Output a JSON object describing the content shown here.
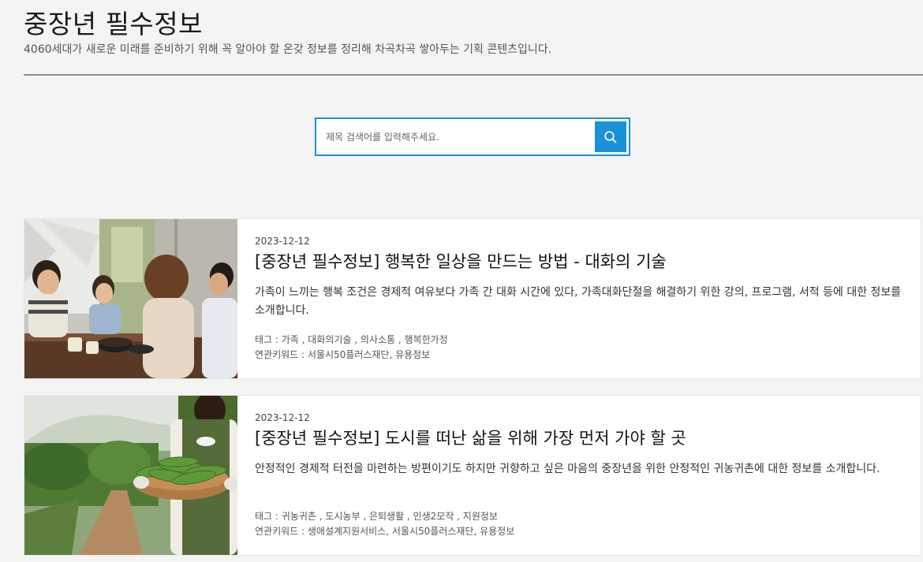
{
  "header": {
    "title": "중장년 필수정보",
    "description": "4060세대가 새로운 미래를 준비하기 위해 꼭 알아야 할 온갖 정보를 정리해 차곡차곡 쌓아두는 기획 콘텐츠입니다."
  },
  "search": {
    "placeholder": "제목 검색어를 입력해주세요.",
    "value": "",
    "icon": "search-icon"
  },
  "colors": {
    "accent": "#1a90d8",
    "background": "#f4f4f4",
    "divider": "#8c8c8c"
  },
  "articles": [
    {
      "date": "2023-12-12",
      "title": "[중장년 필수정보] 행복한 일상을 만드는 방법 - 대화의 기술",
      "summary": "가족이 느끼는 행복 조건은 경제적 여유보다 가족 간 대화 시간에 있다, 가족대화단절을 해결하기 위한 강의, 프로그램, 서적 등에 대한 정보를 소개합니다.",
      "tags": "태그 : 가족 , 대화의기술 , 의사소통 , 행복한가정",
      "keywords": "연관키워드 : 서울시50플러스재단, 유용정보"
    },
    {
      "date": "2023-12-12",
      "title": "[중장년 필수정보] 도시를 떠난 삶을 위해 가장 먼저 가야 할 곳",
      "summary": "안정적인 경제적 터전을 마련하는 방편이기도 하지만 귀향하고 싶은 마음의 중장년을 위한 안정적인 귀농귀촌에 대한 정보를 소개합니다.",
      "tags": "태그 : 귀농귀촌 , 도시농부 , 은퇴생활 , 인생2모작 , 지원정보",
      "keywords": "연관키워드 : 생애설계지원서비스, 서울시50플러스재단, 유용정보"
    }
  ]
}
